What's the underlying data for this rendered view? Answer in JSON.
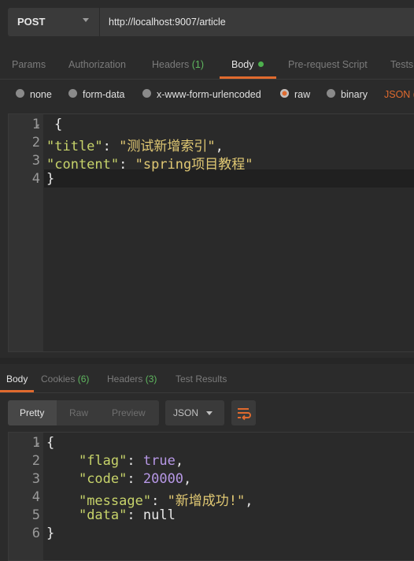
{
  "request": {
    "method": "POST",
    "url": "http://localhost:9007/article"
  },
  "request_tabs": [
    {
      "label": "Params"
    },
    {
      "label": "Authorization"
    },
    {
      "label": "Headers",
      "count": "(1)"
    },
    {
      "label": "Body",
      "active": true
    },
    {
      "label": "Pre-request Script"
    },
    {
      "label": "Tests"
    }
  ],
  "body_options": {
    "none": "none",
    "form_data": "form-data",
    "urlencoded": "x-www-form-urlencoded",
    "raw": "raw",
    "binary": "binary",
    "format": "JSON ("
  },
  "request_body_lines": [
    "1",
    "2",
    "3",
    "4"
  ],
  "request_body": {
    "l1": "{",
    "l2_key": "\"title\"",
    "l2_val": "\"测试新增索引\"",
    "l3_key": "\"content\"",
    "l3_val": "\"spring项目教程\"",
    "l4": "}"
  },
  "response_tabs": [
    {
      "label": "Body",
      "active": true
    },
    {
      "label": "Cookies",
      "count": "(6)"
    },
    {
      "label": "Headers",
      "count": "(3)"
    },
    {
      "label": "Test Results"
    }
  ],
  "view_modes": {
    "pretty": "Pretty",
    "raw": "Raw",
    "preview": "Preview"
  },
  "response_format": "JSON",
  "response_lines": [
    "1",
    "2",
    "3",
    "4",
    "5",
    "6"
  ],
  "response_body": {
    "open": "{",
    "flag_key": "\"flag\"",
    "flag_val": "true",
    "code_key": "\"code\"",
    "code_val": "20000",
    "message_key": "\"message\"",
    "message_val": "\"新增成功!\"",
    "data_key": "\"data\"",
    "data_val": "null",
    "close": "}"
  },
  "colors": {
    "accent": "#e06a2e",
    "count_green": "#5fb75f",
    "json_key": "#c7d36a",
    "json_string": "#e0c873",
    "json_keyword": "#b798e6"
  }
}
